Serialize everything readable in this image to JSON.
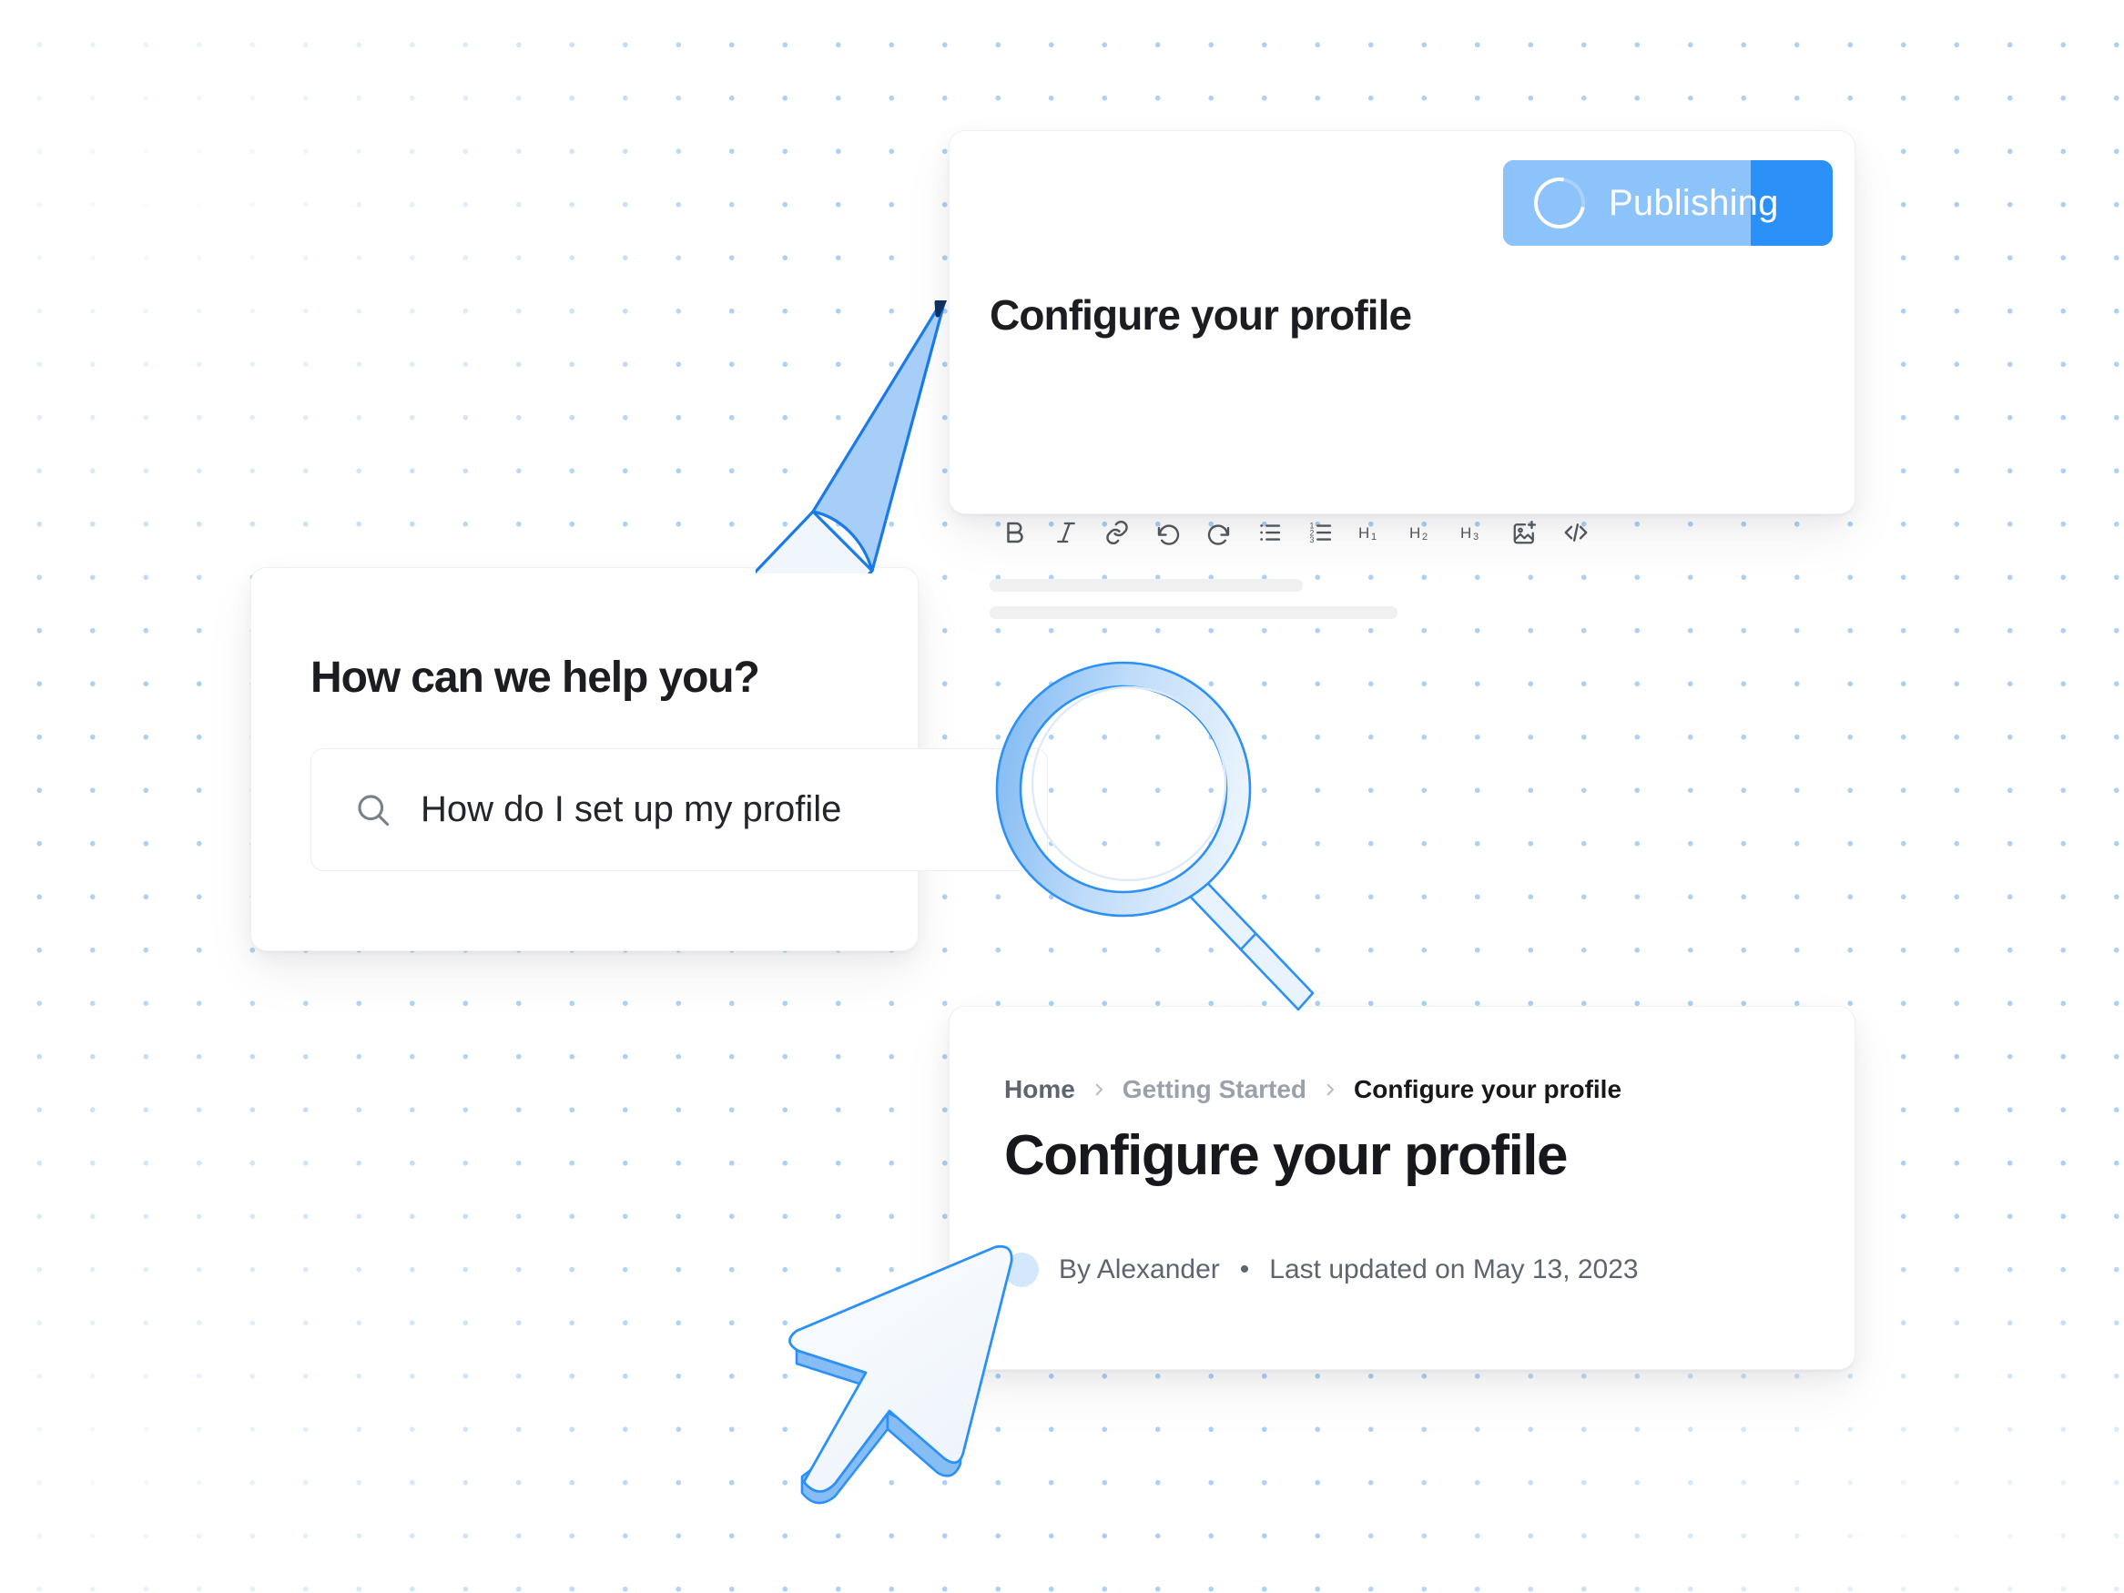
{
  "background": {
    "dot_color": "#a9cdf3",
    "page_bg": "#ffffff"
  },
  "editor_card": {
    "publish_button": {
      "label": "Publishing",
      "progress_percent": 75,
      "progress_color": "#8cc3fa",
      "track_color": "#2b90f7",
      "spinner_icon": "loading-spinner-icon"
    },
    "title": "Configure your profile",
    "toolbar": [
      {
        "name": "bold-icon",
        "label": "B"
      },
      {
        "name": "italic-icon",
        "label": "I"
      },
      {
        "name": "link-icon",
        "label": ""
      },
      {
        "name": "undo-icon",
        "label": ""
      },
      {
        "name": "redo-icon",
        "label": ""
      },
      {
        "name": "bullet-list-icon",
        "label": ""
      },
      {
        "name": "numbered-list-icon",
        "label": ""
      },
      {
        "name": "heading-1-icon",
        "label": "H1"
      },
      {
        "name": "heading-2-icon",
        "label": "H2"
      },
      {
        "name": "heading-3-icon",
        "label": "H3"
      },
      {
        "name": "image-add-icon",
        "label": ""
      },
      {
        "name": "code-icon",
        "label": ""
      }
    ]
  },
  "search_card": {
    "heading": "How can we help you?",
    "search_icon": "search-icon",
    "value": "How do I set up my profile",
    "placeholder": "Search"
  },
  "article_card": {
    "breadcrumb": [
      {
        "label": "Home",
        "current": false
      },
      {
        "label": "Getting Started",
        "current": false
      },
      {
        "label": "Configure your profile",
        "current": true
      }
    ],
    "breadcrumb_separator": "›",
    "title": "Configure your profile",
    "author": "By Alexander",
    "meta_separator": "•",
    "updated": "Last updated on May 13, 2023",
    "avatar_color": "#d5e8fb"
  },
  "illustrations": {
    "pencil": {
      "name": "pencil-illustration",
      "outline": "#1a7ae8",
      "tip": "#8cc3fa",
      "point": "#0d2f63"
    },
    "magnifier": {
      "name": "magnifying-glass-illustration",
      "outline": "#2b90f7",
      "body": "#eaf3fd",
      "shade": "#9dc9f6"
    },
    "cursor": {
      "name": "mouse-cursor-illustration",
      "outline": "#2b90f7",
      "body": "#f2f7fc",
      "shade": "#86bdf4"
    }
  }
}
